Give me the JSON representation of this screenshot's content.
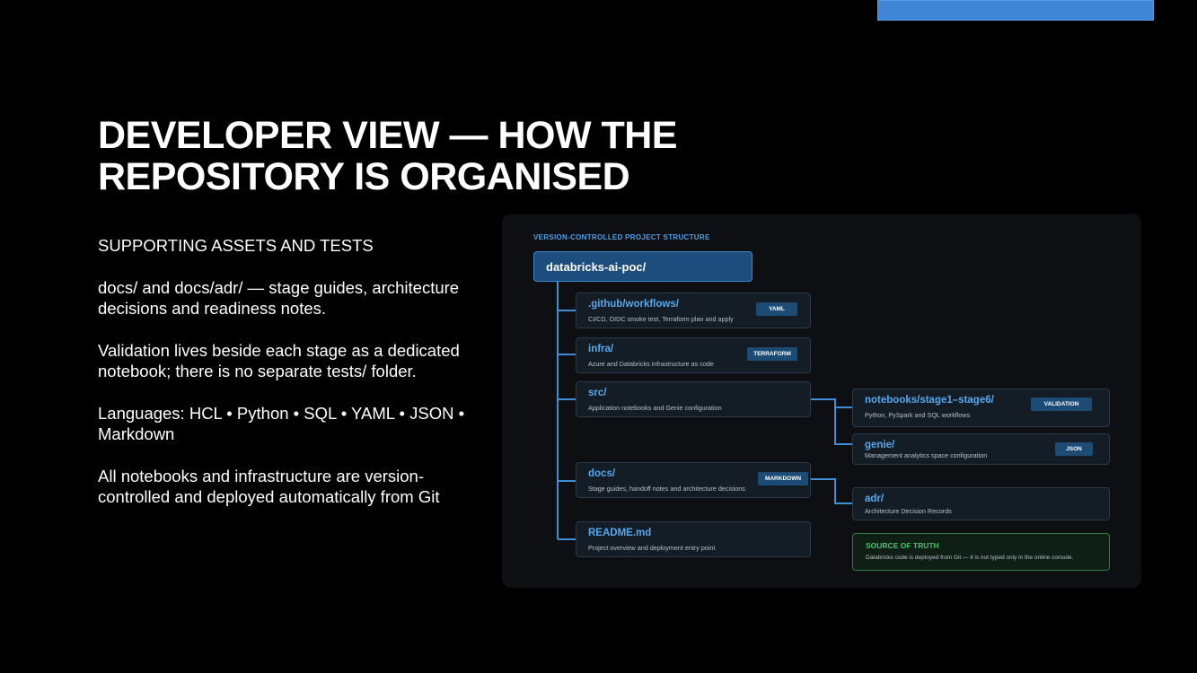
{
  "title": {
    "line1": "DEVELOPER VIEW — HOW THE",
    "line2": "REPOSITORY IS ORGANISED"
  },
  "body": {
    "heading": "SUPPORTING ASSETS AND TESTS",
    "p1": "docs/ and docs/adr/ — stage guides, architecture decisions and readiness notes.",
    "p2": "Validation lives beside each stage as a dedicated notebook; there is no separate tests/ folder.",
    "p3": "Languages: HCL • Python • SQL • YAML • JSON • Markdown",
    "p4": "All notebooks and infrastructure are version-controlled and deployed automatically from Git"
  },
  "diagram": {
    "label": "VERSION-CONTROLLED PROJECT STRUCTURE",
    "root": "databricks-ai-poc/",
    "nodes": [
      {
        "name": ".github/workflows/",
        "desc": "CI/CD, OIDC smoke test, Terraform plan and apply",
        "badge": "YAML"
      },
      {
        "name": "infra/",
        "desc": "Azure and Databricks infrastructure as code",
        "badge": "TERRAFORM"
      },
      {
        "name": "src/",
        "desc": "Application notebooks and Genie configuration",
        "badge": ""
      },
      {
        "name": "docs/",
        "desc": "Stage guides, handoff notes and architecture decisions",
        "badge": "MARKDOWN"
      },
      {
        "name": "README.md",
        "desc": "Project overview and deployment entry point",
        "badge": ""
      }
    ],
    "children": [
      {
        "name": "notebooks/stage1–stage6/",
        "desc": "Python, PySpark and SQL workflows",
        "badge": "VALIDATION"
      },
      {
        "name": "genie/",
        "desc": "Management analytics space configuration",
        "badge": "JSON"
      },
      {
        "name": "adr/",
        "desc": "Architecture Decision Records",
        "badge": ""
      }
    ],
    "truth": {
      "title": "SOURCE OF TRUTH",
      "text": "Databricks code is deployed from Git — it is not typed only in the online console."
    }
  },
  "colors": {
    "accent": "#3f86d6",
    "node_name": "#56a8ec",
    "badge": "#1c4b76",
    "truth": "#49c46b",
    "connector": "#3f8fd8"
  }
}
